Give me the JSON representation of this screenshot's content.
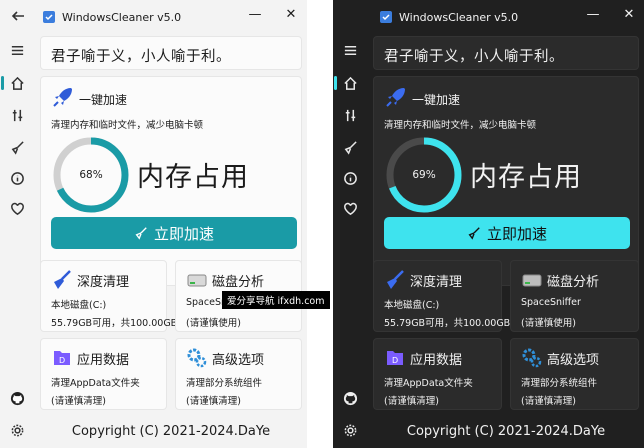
{
  "app_title": "WindowsCleaner v5.0",
  "quote": "君子喻于义，小人喻于利。",
  "boost": {
    "title": "一键加速",
    "description": "清理内存和临时文件，减少电脑卡顿",
    "memory_label": "内存占用",
    "button_label": "立即加速"
  },
  "tiles": {
    "deep_clean": {
      "title": "深度清理",
      "line1": "本地磁盘(C:)"
    },
    "disk_analysis": {
      "title": "磁盘分析",
      "line1": "SpaceSniffer",
      "line2": "(请谨慎使用)"
    },
    "app_data": {
      "title": "应用数据",
      "line1": "清理AppData文件夹",
      "line2": "(请谨慎清理)"
    },
    "advanced": {
      "title": "高级选项",
      "line1": "清理部分系统组件",
      "line2": "(请谨慎清理)"
    }
  },
  "light": {
    "memory_percent_text": "68%",
    "memory_fraction": 0.68,
    "disk_text": "55.79GB可用，共100.00GB"
  },
  "dark": {
    "memory_percent_text": "69%",
    "memory_fraction": 0.69,
    "disk_text": "55.79GB可用，共100.00GB"
  },
  "footer": "Copyright (C) 2021-2024.DaYe",
  "watermark": "爱分享导航 ifxdh.com",
  "colors": {
    "light_accent": "#1a9ba6",
    "dark_accent": "#3ee3ee",
    "rocket": "#2f5bd8",
    "app_purple": "#7b5cff"
  },
  "icons": {
    "nav": [
      "menu-icon",
      "home-icon",
      "tools-icon",
      "broom-icon",
      "info-icon",
      "heart-icon",
      "github-icon",
      "settings-icon"
    ],
    "tiles": [
      "broom-icon",
      "disk-icon",
      "app-data-icon",
      "gears-icon"
    ]
  }
}
